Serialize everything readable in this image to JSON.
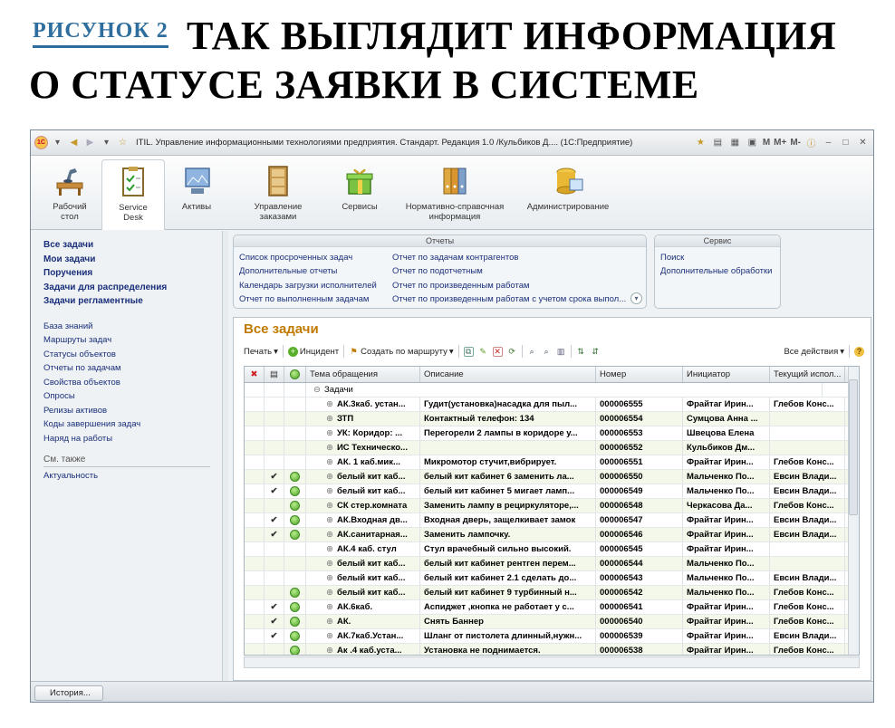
{
  "figure": {
    "label": "РИСУНОК 2",
    "title_line1": "ТАК ВЫГЛЯДИТ ИНФОРМАЦИЯ",
    "title_line2": "О СТАТУСЕ ЗАЯВКИ В СИСТЕМЕ"
  },
  "window": {
    "title": "ITIL. Управление информационными технологиями предприятия. Стандарт. Редакция 1.0 /Кульбиков Д.... (1С:Предприятие)",
    "tb_right": [
      "M",
      "M+",
      "M-"
    ]
  },
  "sections": [
    {
      "label": "Рабочий\nстол",
      "icon": "desk-icon"
    },
    {
      "label": "Service\nDesk",
      "icon": "clipboard-icon"
    },
    {
      "label": "Активы",
      "icon": "assets-icon"
    },
    {
      "label": "Управление\nзаказами",
      "icon": "cabinet-icon"
    },
    {
      "label": "Сервисы",
      "icon": "gift-icon"
    },
    {
      "label": "Нормативно-справочная\nинформация",
      "icon": "binders-icon"
    },
    {
      "label": "Администрирование",
      "icon": "admin-icon"
    }
  ],
  "sidebar": {
    "bold_items": [
      "Все задачи",
      "Мои задачи",
      "Поручения",
      "Задачи для распределения",
      "Задачи регламентные"
    ],
    "items": [
      "База знаний",
      "Маршруты задач",
      "Статусы объектов",
      "Отчеты по задачам",
      "Свойства объектов",
      "Опросы",
      "Релизы активов",
      "Коды завершения задач",
      "Наряд на работы"
    ],
    "see_also": "См. также",
    "see_items": [
      "Актуальность"
    ]
  },
  "reports": {
    "title": "Отчеты",
    "col1": [
      "Список просроченных задач",
      "Дополнительные отчеты",
      "Календарь загрузки исполнителей",
      "Отчет по выполненным задачам"
    ],
    "col2": [
      "Отчет по задачам контрагентов",
      "Отчет по подотчетным",
      "Отчет по произведенным работам",
      "Отчет по произведенным работам с учетом срока выпол..."
    ]
  },
  "service": {
    "title": "Сервис",
    "items": [
      "Поиск",
      "Дополнительные обработки"
    ]
  },
  "main": {
    "title": "Все задачи",
    "print": "Печать",
    "incident": "Инцидент",
    "create_route": "Создать по маршруту",
    "all_actions": "Все действия"
  },
  "table": {
    "columns": [
      "Тема обращения",
      "Описание",
      "Номер",
      "Инициатор",
      "Текущий испол..."
    ],
    "group": "Задачи",
    "rows": [
      {
        "check": "",
        "ok": false,
        "topic": "АК.3каб. устан...",
        "desc": "Гудит(установка)насадка для пыл...",
        "num": "000006555",
        "init": "Фрайтаг Ирин...",
        "exec": "Глебов Конс..."
      },
      {
        "check": "",
        "ok": false,
        "topic": "ЗТП",
        "desc": "Контактный телефон: 134",
        "num": "000006554",
        "init": "Сумцова Анна ...",
        "exec": ""
      },
      {
        "check": "",
        "ok": false,
        "topic": "УК: Коридор: ...",
        "desc": "Перегорели 2 лампы в коридоре у...",
        "num": "000006553",
        "init": "Швецова Елена",
        "exec": ""
      },
      {
        "check": "",
        "ok": false,
        "topic": "ИС Техническо...",
        "desc": "",
        "num": "000006552",
        "init": "Кульбиков Дм...",
        "exec": ""
      },
      {
        "check": "",
        "ok": false,
        "topic": "АК. 1 каб.мик...",
        "desc": "Микромотор стучит,вибрирует.",
        "num": "000006551",
        "init": "Фрайтаг Ирин...",
        "exec": "Глебов Конс..."
      },
      {
        "check": "✔",
        "ok": true,
        "topic": "белый кит каб...",
        "desc": "белый кит кабинет 6 заменить ла...",
        "num": "000006550",
        "init": "Мальченко По...",
        "exec": "Евсин Влади..."
      },
      {
        "check": "✔",
        "ok": true,
        "topic": "белый кит каб...",
        "desc": "белый кит кабинет 5 мигает ламп...",
        "num": "000006549",
        "init": "Мальченко По...",
        "exec": "Евсин Влади..."
      },
      {
        "check": "",
        "ok": true,
        "topic": "СК стер.комната",
        "desc": "Заменить лампу в рециркуляторе,...",
        "num": "000006548",
        "init": "Черкасова Да...",
        "exec": "Глебов Конс..."
      },
      {
        "check": "✔",
        "ok": true,
        "topic": "АК.Входная дв...",
        "desc": "Входная дверь, защелкивает замок",
        "num": "000006547",
        "init": "Фрайтаг Ирин...",
        "exec": "Евсин Влади..."
      },
      {
        "check": "✔",
        "ok": true,
        "topic": "АК.санитарная...",
        "desc": "Заменить лампочку.",
        "num": "000006546",
        "init": "Фрайтаг Ирин...",
        "exec": "Евсин Влади..."
      },
      {
        "check": "",
        "ok": false,
        "topic": "АК.4 каб. стул",
        "desc": "Стул врачебный сильно высокий.",
        "num": "000006545",
        "init": "Фрайтаг Ирин...",
        "exec": ""
      },
      {
        "check": "",
        "ok": false,
        "topic": "белый кит каб...",
        "desc": "белый кит кабинет рентген перем...",
        "num": "000006544",
        "init": "Мальченко По...",
        "exec": ""
      },
      {
        "check": "",
        "ok": false,
        "topic": "белый кит каб...",
        "desc": "белый кит кабинет 2.1 сделать до...",
        "num": "000006543",
        "init": "Мальченко По...",
        "exec": "Евсин Влади..."
      },
      {
        "check": "",
        "ok": true,
        "topic": "белый кит каб...",
        "desc": "белый кит кабинет 9 турбинный н...",
        "num": "000006542",
        "init": "Мальченко По...",
        "exec": "Глебов Конс..."
      },
      {
        "check": "✔",
        "ok": true,
        "topic": "АК.6каб.",
        "desc": "Аспиджет ,кнопка не работает у с...",
        "num": "000006541",
        "init": "Фрайтаг Ирин...",
        "exec": "Глебов Конс..."
      },
      {
        "check": "✔",
        "ok": true,
        "topic": "АК.",
        "desc": "Снять Баннер",
        "num": "000006540",
        "init": "Фрайтаг Ирин...",
        "exec": "Глебов Конс..."
      },
      {
        "check": "✔",
        "ok": true,
        "topic": "АК.7каб.Устан...",
        "desc": "Шланг от пистолета длинный,нужн...",
        "num": "000006539",
        "init": "Фрайтаг Ирин...",
        "exec": "Евсин Влади..."
      },
      {
        "check": "",
        "ok": true,
        "topic": "Ак .4 каб.уста...",
        "desc": "Установка не поднимается.",
        "num": "000006538",
        "init": "Фрайтаг Ирин...",
        "exec": "Глебов Конс..."
      }
    ]
  },
  "statusbar": {
    "history": "История..."
  },
  "colors": {
    "accent_title": "#c07a00",
    "link": "#1a2f7a",
    "figure_label": "#2e6e9e"
  }
}
